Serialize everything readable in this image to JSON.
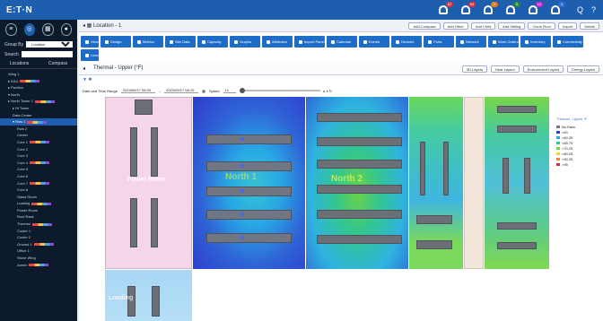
{
  "app": {
    "brand": "E:T·N"
  },
  "alerts": [
    {
      "count": "87",
      "color": "#d9333f"
    },
    {
      "count": "93",
      "color": "#d9333f"
    },
    {
      "count": "0",
      "color": "#e27f1f"
    },
    {
      "count": "5",
      "color": "#2c8a3a"
    },
    {
      "count": "12",
      "color": "#c52ac9"
    },
    {
      "count": "3",
      "color": "#2f6ed1"
    }
  ],
  "topbar": {
    "search": "Q",
    "help": "?"
  },
  "sidebar": {
    "group_label": "Group By",
    "group_value": "Location",
    "search_label": "Search",
    "search_placeholder": "",
    "tabs": [
      "Locations",
      "Compass"
    ],
    "tree": [
      "Wing 1",
      "▸ EAU",
      "▸ Pavilion",
      "▾ North",
      "▸ North Tower 1",
      "▸ Hi Tower",
      "Data Center",
      "▾ Row 1",
      "Row 2",
      "Center",
      "Core 1",
      "Core 2",
      "Core 3",
      "Core 4",
      "Core 5",
      "Core 6",
      "Core 7",
      "Core 8",
      "Glass Room",
      "Loading",
      "Power Room",
      "Roof Rack",
      "Thermal",
      "Cooler 1",
      "Cooler 2",
      "Ground 1",
      "Office 1",
      "Stone Wing",
      "Annex"
    ]
  },
  "location": {
    "title": "◂  ▦  Location - 1",
    "buttons": [
      "Add Compass",
      "Add Other",
      "Add Child",
      "Add Sibling",
      "Clone Floor",
      "Import",
      "Delete"
    ]
  },
  "navtabs": [
    "View",
    "Design",
    "Metrics",
    "Site Data",
    "Capacity",
    "Graphs",
    "Attributes",
    "Import Panel",
    "Calendar",
    "Events",
    "Devices",
    "Ports",
    "Network",
    "Work Orders",
    "Inventory",
    "Connectivity",
    "Links"
  ],
  "subhead": {
    "title": "Thermal - Upper (°F)",
    "layers": [
      "3D Layers",
      "Heat Layers",
      "Environment Layers",
      "Energy Layers"
    ]
  },
  "filter": "▼ ✱",
  "daterange": {
    "label": "Date and Time Range",
    "start": "2023/09/17 08:00",
    "end": "2023/09/17 08:10",
    "speed_label": "Speed",
    "speed_value": "1x",
    "controls": "▸  ⏸  ↻"
  },
  "rooms": {
    "power": "Power Room",
    "r2": "North 1",
    "r3": "North 2",
    "r4": "Loading"
  },
  "legend": {
    "title": "Thermal - Upper °F",
    "items": [
      {
        "label": "No Data",
        "color": "#777777"
      },
      {
        "label": "<60",
        "color": "#2d44d0"
      },
      {
        "label": "<60.25",
        "color": "#2aa8e8"
      },
      {
        "label": "<65.75",
        "color": "#2ac9a7"
      },
      {
        "label": "<70.25",
        "color": "#71d64a"
      },
      {
        "label": "<80.25",
        "color": "#f0d23c"
      },
      {
        "label": "<90.25",
        "color": "#f08a2c"
      },
      {
        "label": ">95",
        "color": "#d9333f"
      }
    ]
  }
}
